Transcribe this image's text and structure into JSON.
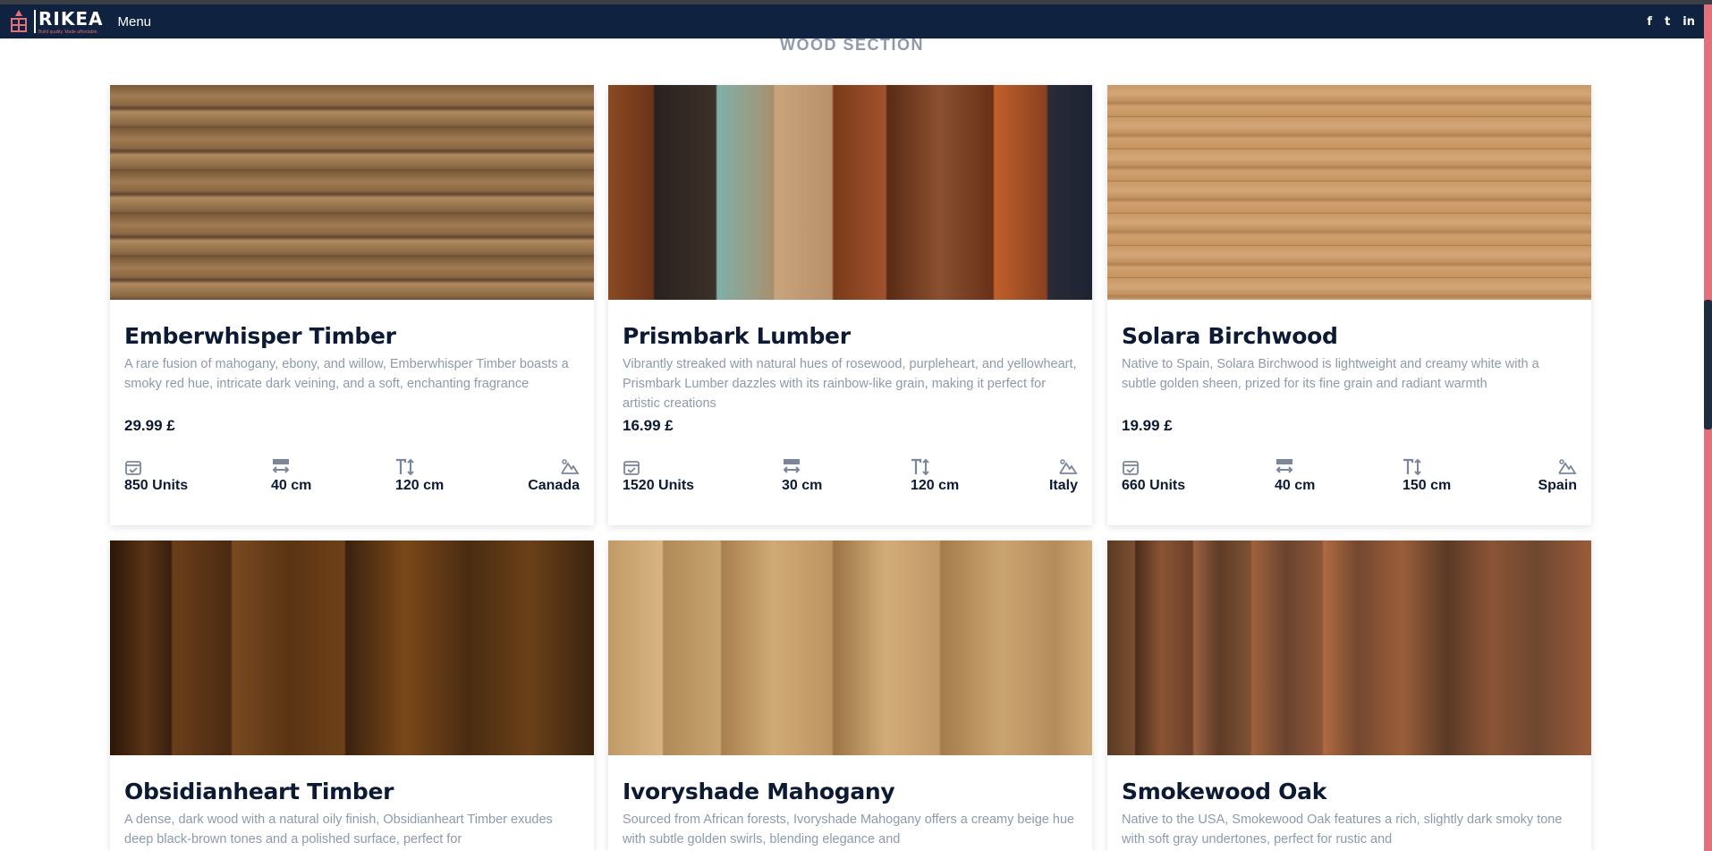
{
  "brand": {
    "name": "RIKEA",
    "tagline": "Build quality. Made affordable."
  },
  "nav": {
    "menu_label": "Menu",
    "social": [
      "f",
      "t",
      "in"
    ]
  },
  "section": {
    "title": "WOOD SECTION"
  },
  "products": [
    {
      "title": "Emberwhisper Timber",
      "description": "A rare fusion of mahogany, ebony, and willow, Emberwhisper Timber boasts a smoky red hue, intricate dark veining, and a soft, enchanting fragrance",
      "price": "29.99 £",
      "units": "850 Units",
      "width": "40 cm",
      "height": "120 cm",
      "origin": "Canada"
    },
    {
      "title": "Prismbark Lumber",
      "description": "Vibrantly streaked with natural hues of rosewood, purpleheart, and yellowheart, Prismbark Lumber dazzles with its rainbow-like grain, making it perfect for artistic creations",
      "price": "16.99 £",
      "units": "1520 Units",
      "width": "30 cm",
      "height": "120 cm",
      "origin": "Italy"
    },
    {
      "title": "Solara Birchwood",
      "description": "Native to Spain, Solara Birchwood is lightweight and creamy white with a subtle golden sheen, prized for its fine grain and radiant warmth",
      "price": "19.99 £",
      "units": "660 Units",
      "width": "40 cm",
      "height": "150 cm",
      "origin": "Spain"
    },
    {
      "title": "Obsidianheart Timber",
      "description": "A dense, dark wood with a natural oily finish, Obsidianheart Timber exudes deep black-brown tones and a polished surface, perfect for",
      "price": "",
      "units": "",
      "width": "",
      "height": "",
      "origin": ""
    },
    {
      "title": "Ivoryshade Mahogany",
      "description": "Sourced from African forests, Ivoryshade Mahogany offers a creamy beige hue with subtle golden swirls, blending elegance and",
      "price": "",
      "units": "",
      "width": "",
      "height": "",
      "origin": ""
    },
    {
      "title": "Smokewood Oak",
      "description": "Native to the USA, Smokewood Oak features a rich, slightly dark smoky tone with soft gray undertones, perfect for rustic and",
      "price": "",
      "units": "",
      "width": "",
      "height": "",
      "origin": ""
    }
  ],
  "colors": {
    "navbar": "#0f2240",
    "accent": "#e3707a",
    "text_dark": "#0d1a33",
    "text_muted": "#8e9aab"
  }
}
